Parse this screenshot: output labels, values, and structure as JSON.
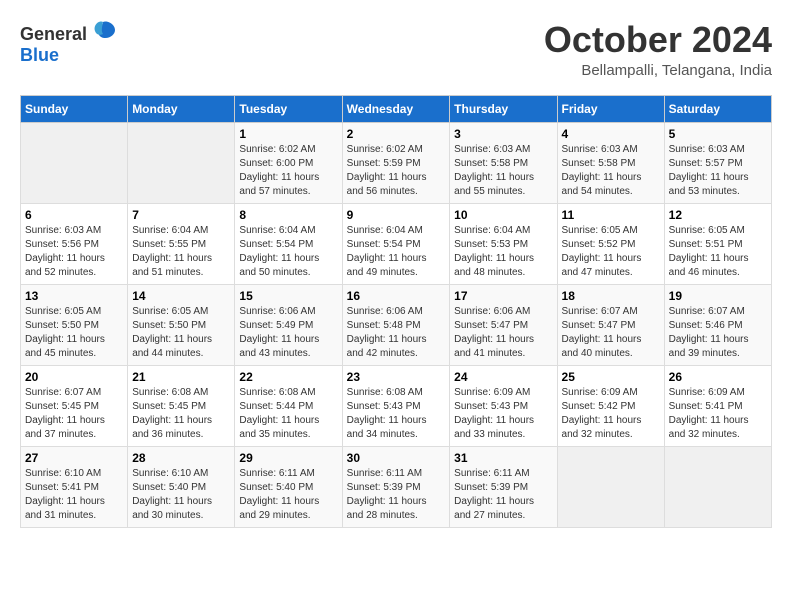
{
  "header": {
    "logo": {
      "text_general": "General",
      "text_blue": "Blue"
    },
    "title": "October 2024",
    "location": "Bellampalli, Telangana, India"
  },
  "calendar": {
    "days_of_week": [
      "Sunday",
      "Monday",
      "Tuesday",
      "Wednesday",
      "Thursday",
      "Friday",
      "Saturday"
    ],
    "weeks": [
      [
        {
          "day": "",
          "info": ""
        },
        {
          "day": "",
          "info": ""
        },
        {
          "day": "1",
          "info": "Sunrise: 6:02 AM\nSunset: 6:00 PM\nDaylight: 11 hours and 57 minutes."
        },
        {
          "day": "2",
          "info": "Sunrise: 6:02 AM\nSunset: 5:59 PM\nDaylight: 11 hours and 56 minutes."
        },
        {
          "day": "3",
          "info": "Sunrise: 6:03 AM\nSunset: 5:58 PM\nDaylight: 11 hours and 55 minutes."
        },
        {
          "day": "4",
          "info": "Sunrise: 6:03 AM\nSunset: 5:58 PM\nDaylight: 11 hours and 54 minutes."
        },
        {
          "day": "5",
          "info": "Sunrise: 6:03 AM\nSunset: 5:57 PM\nDaylight: 11 hours and 53 minutes."
        }
      ],
      [
        {
          "day": "6",
          "info": "Sunrise: 6:03 AM\nSunset: 5:56 PM\nDaylight: 11 hours and 52 minutes."
        },
        {
          "day": "7",
          "info": "Sunrise: 6:04 AM\nSunset: 5:55 PM\nDaylight: 11 hours and 51 minutes."
        },
        {
          "day": "8",
          "info": "Sunrise: 6:04 AM\nSunset: 5:54 PM\nDaylight: 11 hours and 50 minutes."
        },
        {
          "day": "9",
          "info": "Sunrise: 6:04 AM\nSunset: 5:54 PM\nDaylight: 11 hours and 49 minutes."
        },
        {
          "day": "10",
          "info": "Sunrise: 6:04 AM\nSunset: 5:53 PM\nDaylight: 11 hours and 48 minutes."
        },
        {
          "day": "11",
          "info": "Sunrise: 6:05 AM\nSunset: 5:52 PM\nDaylight: 11 hours and 47 minutes."
        },
        {
          "day": "12",
          "info": "Sunrise: 6:05 AM\nSunset: 5:51 PM\nDaylight: 11 hours and 46 minutes."
        }
      ],
      [
        {
          "day": "13",
          "info": "Sunrise: 6:05 AM\nSunset: 5:50 PM\nDaylight: 11 hours and 45 minutes."
        },
        {
          "day": "14",
          "info": "Sunrise: 6:05 AM\nSunset: 5:50 PM\nDaylight: 11 hours and 44 minutes."
        },
        {
          "day": "15",
          "info": "Sunrise: 6:06 AM\nSunset: 5:49 PM\nDaylight: 11 hours and 43 minutes."
        },
        {
          "day": "16",
          "info": "Sunrise: 6:06 AM\nSunset: 5:48 PM\nDaylight: 11 hours and 42 minutes."
        },
        {
          "day": "17",
          "info": "Sunrise: 6:06 AM\nSunset: 5:47 PM\nDaylight: 11 hours and 41 minutes."
        },
        {
          "day": "18",
          "info": "Sunrise: 6:07 AM\nSunset: 5:47 PM\nDaylight: 11 hours and 40 minutes."
        },
        {
          "day": "19",
          "info": "Sunrise: 6:07 AM\nSunset: 5:46 PM\nDaylight: 11 hours and 39 minutes."
        }
      ],
      [
        {
          "day": "20",
          "info": "Sunrise: 6:07 AM\nSunset: 5:45 PM\nDaylight: 11 hours and 37 minutes."
        },
        {
          "day": "21",
          "info": "Sunrise: 6:08 AM\nSunset: 5:45 PM\nDaylight: 11 hours and 36 minutes."
        },
        {
          "day": "22",
          "info": "Sunrise: 6:08 AM\nSunset: 5:44 PM\nDaylight: 11 hours and 35 minutes."
        },
        {
          "day": "23",
          "info": "Sunrise: 6:08 AM\nSunset: 5:43 PM\nDaylight: 11 hours and 34 minutes."
        },
        {
          "day": "24",
          "info": "Sunrise: 6:09 AM\nSunset: 5:43 PM\nDaylight: 11 hours and 33 minutes."
        },
        {
          "day": "25",
          "info": "Sunrise: 6:09 AM\nSunset: 5:42 PM\nDaylight: 11 hours and 32 minutes."
        },
        {
          "day": "26",
          "info": "Sunrise: 6:09 AM\nSunset: 5:41 PM\nDaylight: 11 hours and 32 minutes."
        }
      ],
      [
        {
          "day": "27",
          "info": "Sunrise: 6:10 AM\nSunset: 5:41 PM\nDaylight: 11 hours and 31 minutes."
        },
        {
          "day": "28",
          "info": "Sunrise: 6:10 AM\nSunset: 5:40 PM\nDaylight: 11 hours and 30 minutes."
        },
        {
          "day": "29",
          "info": "Sunrise: 6:11 AM\nSunset: 5:40 PM\nDaylight: 11 hours and 29 minutes."
        },
        {
          "day": "30",
          "info": "Sunrise: 6:11 AM\nSunset: 5:39 PM\nDaylight: 11 hours and 28 minutes."
        },
        {
          "day": "31",
          "info": "Sunrise: 6:11 AM\nSunset: 5:39 PM\nDaylight: 11 hours and 27 minutes."
        },
        {
          "day": "",
          "info": ""
        },
        {
          "day": "",
          "info": ""
        }
      ]
    ]
  }
}
